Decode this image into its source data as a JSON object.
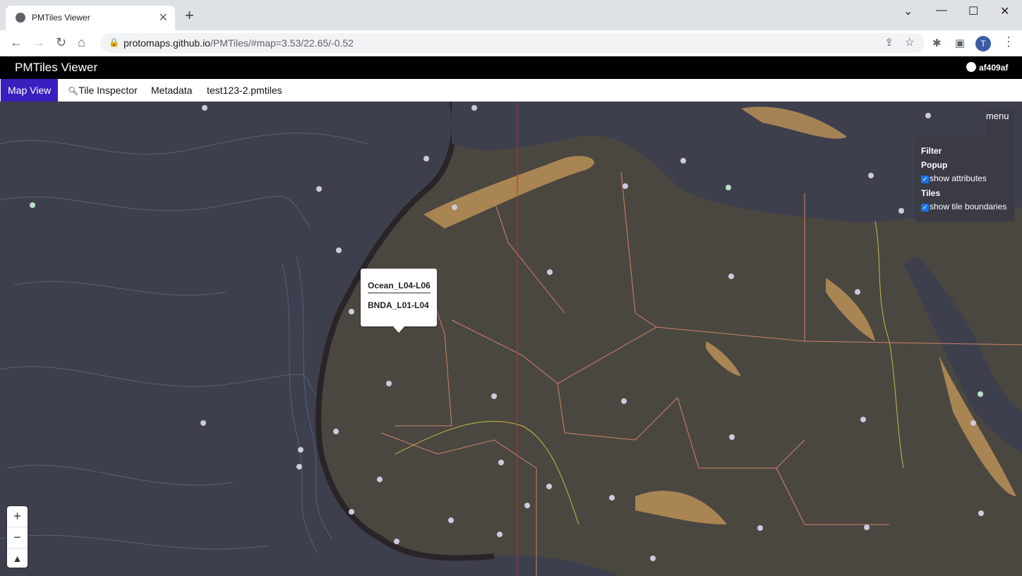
{
  "browser": {
    "tab_title": "PMTiles Viewer",
    "tab_close": "✕",
    "new_tab": "+",
    "url_host": "protomaps.github.io",
    "url_path": "/PMTiles/#map=3.53/22.65/-0.52",
    "profile_initial": "T"
  },
  "app": {
    "title": "PMTiles Viewer",
    "github_label": "af409af",
    "tabs": [
      "Map View",
      "Tile Inspector",
      "Metadata",
      "test123-2.pmtiles"
    ]
  },
  "popup": {
    "layer_1": "Ocean_L04-L06",
    "layer_2": "BNDA_L01-L04"
  },
  "menu": {
    "toggle": "menu",
    "filter_heading": "Filter",
    "popup_heading": "Popup",
    "show_attributes": "show attributes",
    "show_attributes_checked": true,
    "tiles_heading": "Tiles",
    "show_tile_boundaries": "show tile boundaries",
    "show_tile_boundaries_checked": true
  },
  "zoom": {
    "in": "+",
    "out": "−",
    "compass": "▲"
  },
  "colors": {
    "ocean": "#3e3f4c",
    "land": "#4a4740",
    "relief": "#c89a5a",
    "boundary": "#d0816b",
    "river": "#c9b84a",
    "tile_boundary": "#e02020",
    "active_tab": "#3a1fbf"
  }
}
